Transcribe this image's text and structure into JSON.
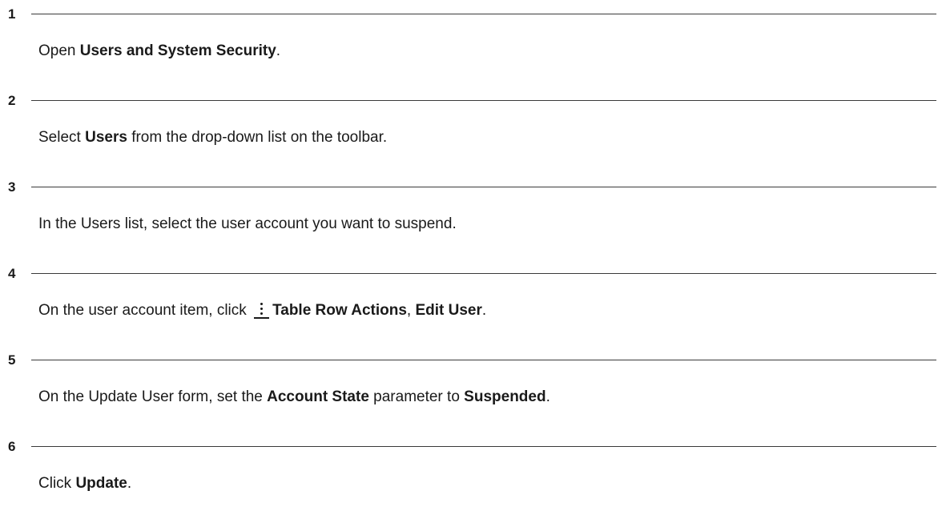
{
  "steps": [
    {
      "number": "1",
      "parts": {
        "a": "Open ",
        "b": "Users and System Security",
        "c": "."
      }
    },
    {
      "number": "2",
      "parts": {
        "a": "Select ",
        "b": "Users",
        "c": " from the drop-down list on the toolbar."
      }
    },
    {
      "number": "3",
      "parts": {
        "a": "In the Users list, select the user account you want to suspend."
      }
    },
    {
      "number": "4",
      "parts": {
        "a": "On the user account item, click ",
        "icon": "kebab-menu-icon",
        "b": "Table Row Actions",
        "c": ", ",
        "d": "Edit User",
        "e": "."
      }
    },
    {
      "number": "5",
      "parts": {
        "a": "On the Update User form, set the ",
        "b": "Account State",
        "c": " parameter to ",
        "d": "Suspended",
        "e": "."
      }
    },
    {
      "number": "6",
      "parts": {
        "a": "Click ",
        "b": "Update",
        "c": "."
      }
    }
  ]
}
